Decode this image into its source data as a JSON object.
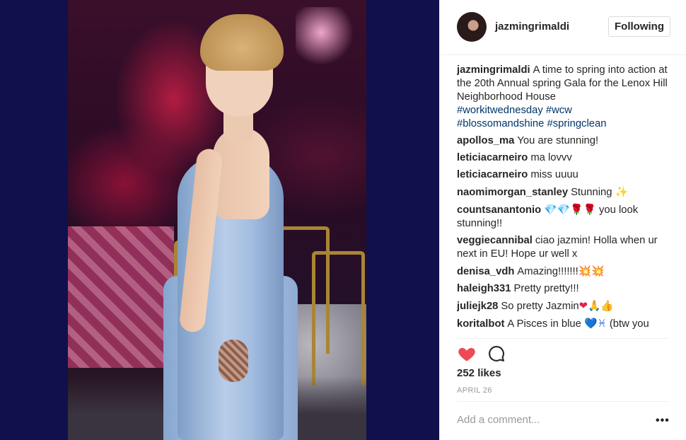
{
  "post": {
    "username": "jazmingrimaldi",
    "follow_label": "Following",
    "caption": {
      "user": "jazmingrimaldi",
      "text": "A time to spring into action at the 20th Annual spring Gala for the Lenox Hill Neighborhood House",
      "hashtags": [
        "#workitwednesday",
        "#wcw",
        "#blossomandshine",
        "#springclean"
      ]
    },
    "comments": [
      {
        "user": "apollos_ma",
        "text": "You are stunning!"
      },
      {
        "user": "leticiacarneiro",
        "text": "ma lovvv"
      },
      {
        "user": "leticiacarneiro",
        "text": "miss uuuu"
      },
      {
        "user": "naomimorgan_stanley",
        "text": "Stunning",
        "emoji": "✨"
      },
      {
        "user": "countsanantonio",
        "emoji_prefix": "💎💎🌹🌹",
        "text": "you look stunning!!"
      },
      {
        "user": "veggiecannibal",
        "text": "ciao jazmin! Holla when ur next in EU! Hope ur well x"
      },
      {
        "user": "denisa_vdh",
        "text": "Amazing!!!!!!!",
        "emoji": "💥💥"
      },
      {
        "user": "haleigh331",
        "text": "Pretty pretty!!!"
      },
      {
        "user": "juliejk28",
        "text": "So pretty Jazmin",
        "emoji": "❤🙏👍"
      },
      {
        "user": "koritalbot",
        "text_before": "A Pisces in blue",
        "emoji": "💙♓",
        "text_after": "(btw you"
      }
    ],
    "likes": "252 likes",
    "date": "APRIL 26",
    "add_comment_placeholder": "Add a comment...",
    "more_label": "•••"
  },
  "icons": {
    "like": "heart-icon",
    "comment": "comment-bubble-icon",
    "more": "more-options-icon"
  },
  "colors": {
    "like_red": "#ed4956",
    "hashtag_blue": "#003569",
    "photo_bg": "#10104c"
  }
}
